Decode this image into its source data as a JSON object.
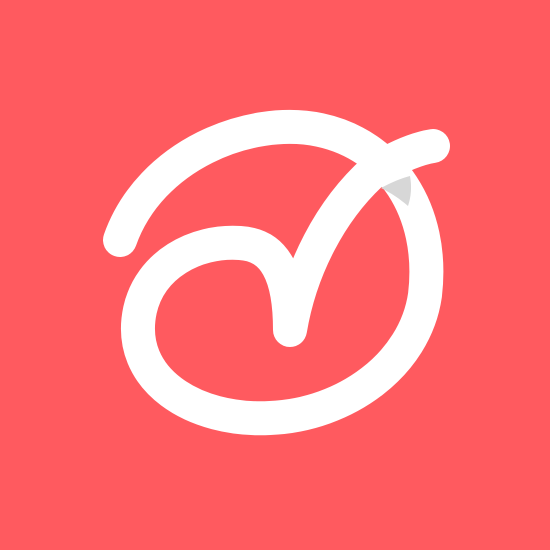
{
  "app_icon": {
    "icon_name": "checkmark-swirl-logo-icon",
    "colors": {
      "background": "#ff5a5f",
      "mark": "#ffffff",
      "fold_shade": "#d7d7d7"
    }
  }
}
